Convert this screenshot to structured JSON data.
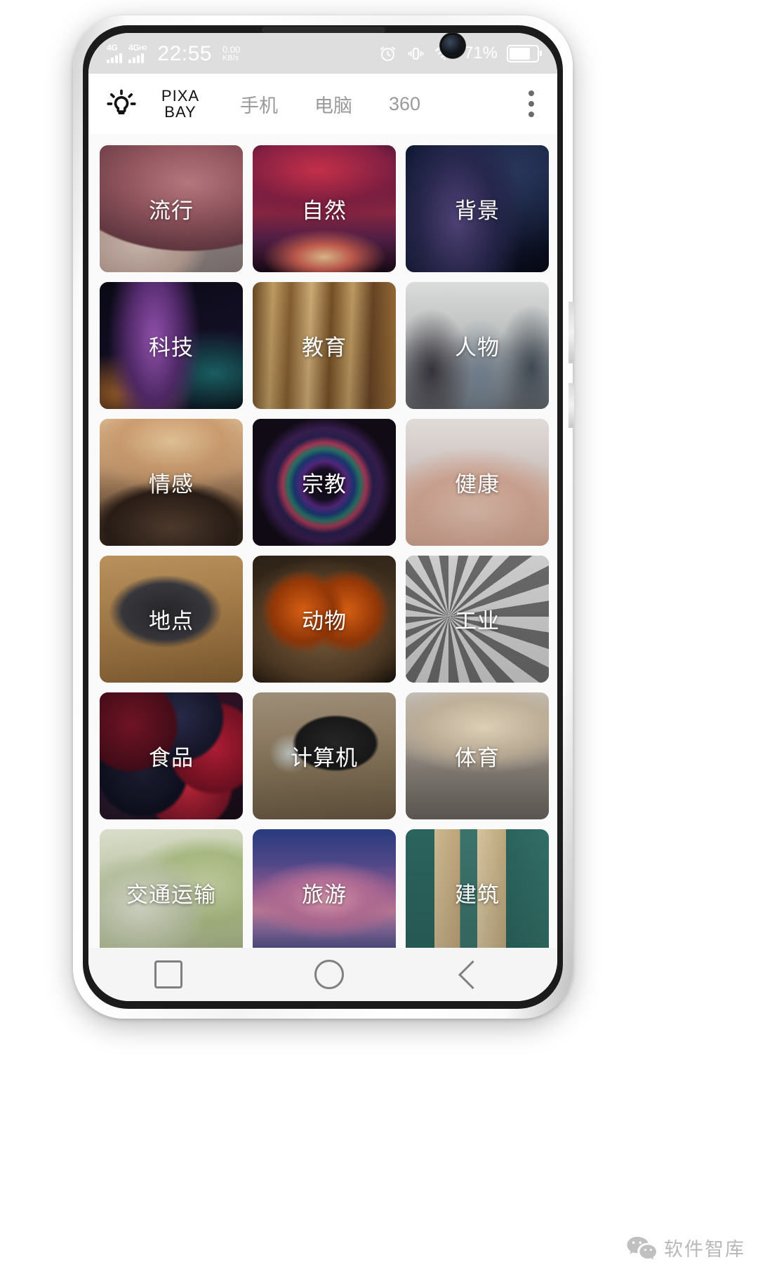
{
  "status_bar": {
    "network_primary": "4G",
    "network_secondary": "4G",
    "network_secondary_sup": "HD",
    "time": "22:55",
    "net_speed_value": "0.00",
    "net_speed_unit": "KB/s",
    "battery_percent": "71%",
    "icons": [
      "alarm-icon",
      "vibrate-icon",
      "wifi-icon",
      "battery-icon"
    ]
  },
  "header": {
    "logo_icon": "lightbulb-icon",
    "brand_line1": "PIXA",
    "brand_line2": "BAY",
    "tabs": [
      {
        "label": "手机"
      },
      {
        "label": "电脑"
      },
      {
        "label": "360"
      }
    ],
    "overflow_icon": "more-vertical-icon"
  },
  "grid": {
    "tiles": [
      {
        "label": "流行",
        "art": "art-pop"
      },
      {
        "label": "自然",
        "art": "art-nature"
      },
      {
        "label": "背景",
        "art": "art-bg"
      },
      {
        "label": "科技",
        "art": "art-tech"
      },
      {
        "label": "教育",
        "art": "art-edu"
      },
      {
        "label": "人物",
        "art": "art-people"
      },
      {
        "label": "情感",
        "art": "art-emotion"
      },
      {
        "label": "宗教",
        "art": "art-religion"
      },
      {
        "label": "健康",
        "art": "art-health"
      },
      {
        "label": "地点",
        "art": "art-place"
      },
      {
        "label": "动物",
        "art": "art-animal"
      },
      {
        "label": "工业",
        "art": "art-industry"
      },
      {
        "label": "食品",
        "art": "art-food"
      },
      {
        "label": "计算机",
        "art": "art-computer"
      },
      {
        "label": "体育",
        "art": "art-sport"
      },
      {
        "label": "交通运输",
        "art": "art-transport"
      },
      {
        "label": "旅游",
        "art": "art-travel"
      },
      {
        "label": "建筑",
        "art": "art-building"
      }
    ]
  },
  "nav_bar": {
    "recent_label": "recent-apps-icon",
    "home_label": "home-icon",
    "back_label": "back-icon"
  },
  "watermark": {
    "icon": "wechat-icon",
    "text": "软件智库"
  },
  "colors": {
    "status_bar_bg": "#dedede",
    "grid_bg": "#fafafa",
    "tab_inactive": "#9a9a9a",
    "nav_icon": "#808080",
    "brand_text": "#111111"
  }
}
